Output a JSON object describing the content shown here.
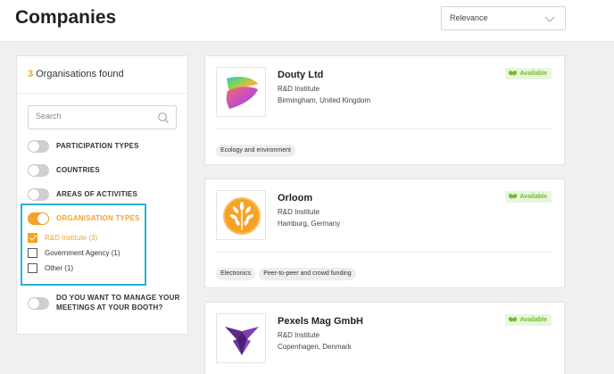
{
  "header": {
    "title": "Companies",
    "sort": {
      "selected": "Relevance"
    }
  },
  "filters": {
    "found_count": "3",
    "found_label": "Organisations found",
    "search_placeholder": "Search",
    "groups": [
      {
        "label": "PARTICIPATION TYPES",
        "on": false
      },
      {
        "label": "COUNTRIES",
        "on": false
      },
      {
        "label": "AREAS OF ACTIVITIES",
        "on": false
      },
      {
        "label": "ORGANISATION TYPES",
        "on": true
      }
    ],
    "organisation_types": [
      {
        "label": "R&D Institute (3)",
        "checked": true
      },
      {
        "label": "Government Agency (1)",
        "checked": false
      },
      {
        "label": "Other (1)",
        "checked": false
      }
    ],
    "meetings": {
      "label": "DO YOU WANT TO MANAGE YOUR MEETINGS AT YOUR BOOTH?",
      "on": false
    }
  },
  "companies": [
    {
      "name": "Douty Ltd",
      "type": "R&D Institute",
      "location": "Birmingham, United Kingdom",
      "status": "Available",
      "tags": [
        "Ecology and environment"
      ],
      "logo": "gradient-wave-logo"
    },
    {
      "name": "Orloom",
      "type": "R&D Institute",
      "location": "Hamburg, Germany",
      "status": "Available",
      "tags": [
        "Electronics",
        "Peer-to-peer and crowd funding"
      ],
      "logo": "orange-leaf-logo"
    },
    {
      "name": "Pexels Mag GmbH",
      "type": "R&D Institute",
      "location": "Copenhagen, Denmark",
      "status": "Available",
      "tags": [],
      "logo": "purple-triangle-logo"
    }
  ],
  "colors": {
    "accent": "#f7a227",
    "available": "#6fbf2c",
    "highlight": "#29b0e0"
  }
}
